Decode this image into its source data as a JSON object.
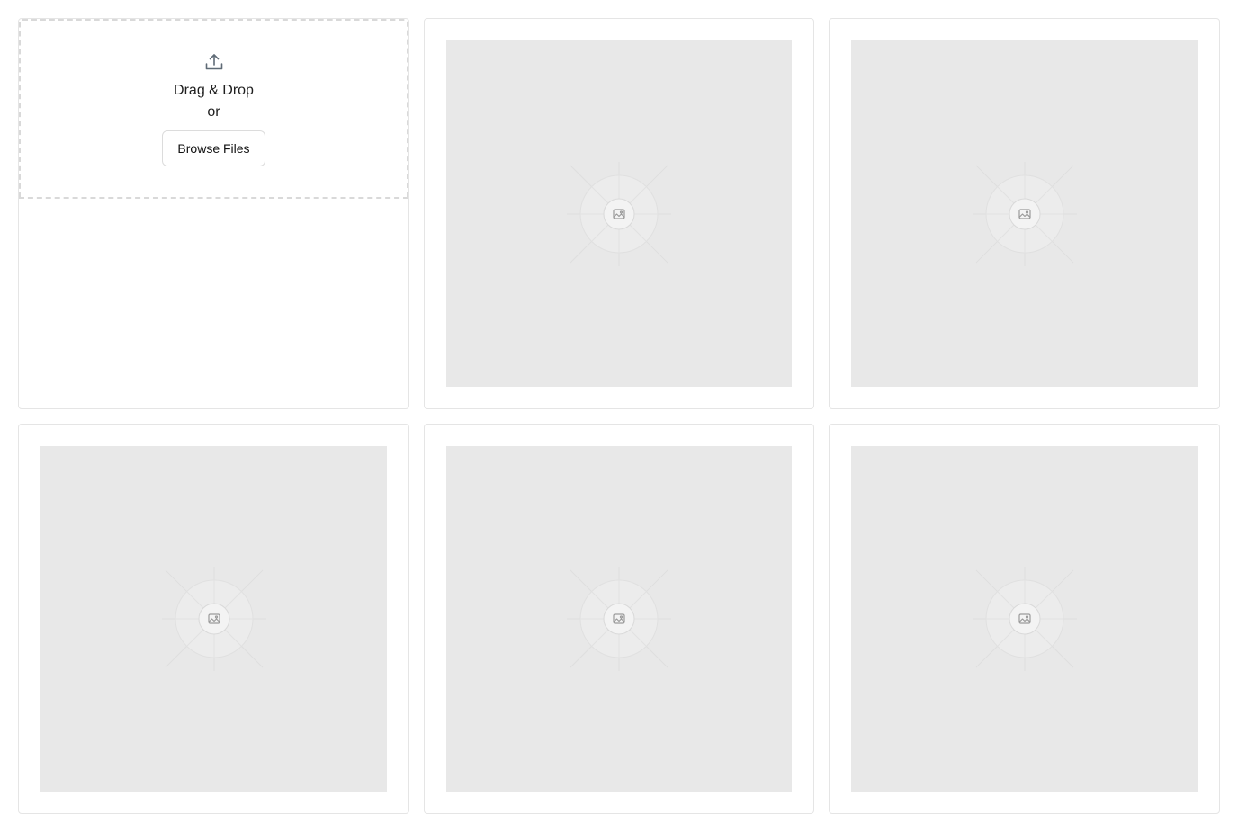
{
  "upload": {
    "icon": "upload-icon",
    "title": "Drag & Drop",
    "or_text": "or",
    "browse_label": "Browse Files"
  },
  "gallery": {
    "items": [
      {
        "icon": "image-placeholder-icon"
      },
      {
        "icon": "image-placeholder-icon"
      },
      {
        "icon": "image-placeholder-icon"
      },
      {
        "icon": "image-placeholder-icon"
      },
      {
        "icon": "image-placeholder-icon"
      }
    ]
  },
  "colors": {
    "placeholder_bg": "#e8e8e8",
    "border": "#e5e5e5",
    "dashed_border": "#d9d9d9"
  }
}
